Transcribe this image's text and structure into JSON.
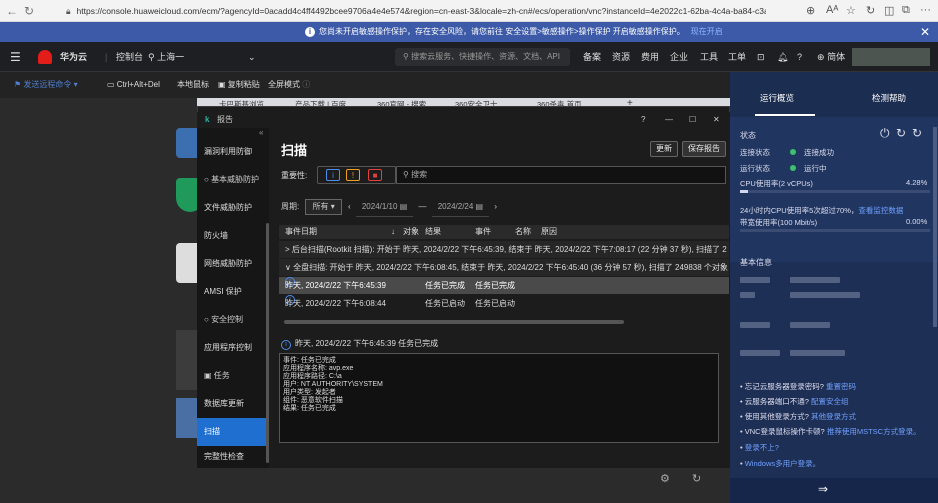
{
  "browser": {
    "url": "https://console.huaweicloud.com/ecm/?agencyId=0acadd4c4ff4492bcee9706a4e4e574&region=cn-east-3&locale=zh-cn#/ecs/operation/vnc?instanceId=4e2022c1-62ba-4c4a-ba84-c3a091d7a240",
    "zoom": "Aᴬ",
    "dots": "···"
  },
  "notice": {
    "text": "您尚未开启敏感操作保护，存在安全风险，请您前往 安全设置>敏感操作>操作保护 开启敏感操作保护。",
    "link": "现在开启",
    "close": "✕"
  },
  "header": {
    "brand": "华为云",
    "console": "控制台",
    "region": "上海一",
    "search_placeholder": "搜索云服务、快捷操作、资源、文档、API",
    "links": [
      "备案",
      "资源",
      "费用",
      "企业",
      "工具",
      "工单"
    ],
    "lang": "简体"
  },
  "vnc_toolbar": {
    "send_remote": "发送远程命令",
    "ctrl_alt_del": "Ctrl+Alt+Del",
    "local_mouse": "本地鼠标",
    "copy_paste": "复制粘贴",
    "fullscreen": "全屏模式"
  },
  "remote": {
    "tabs": [
      "卡巴斯基浏览...",
      "产品下载 | 百度...",
      "360官网 - 搜索...",
      "360安全卫士...",
      "360杀毒 首页..."
    ],
    "app_title": "报告",
    "window_controls": [
      "?",
      "—",
      "☐",
      "✕"
    ],
    "sidebar": [
      {
        "label": "漏洞利用防御",
        "section": false,
        "active": false
      },
      {
        "label": "基本威胁防护",
        "section": true,
        "active": false
      },
      {
        "label": "文件威胁防护",
        "section": false,
        "active": false
      },
      {
        "label": "防火墙",
        "section": false,
        "active": false
      },
      {
        "label": "网络威胁防护",
        "section": false,
        "active": false
      },
      {
        "label": "AMSI 保护",
        "section": false,
        "active": false
      },
      {
        "label": "安全控制",
        "section": true,
        "active": false
      },
      {
        "label": "应用程序控制",
        "section": false,
        "active": false
      },
      {
        "label": "任务",
        "section": true,
        "active": false
      },
      {
        "label": "数据库更新",
        "section": false,
        "active": false
      },
      {
        "label": "扫描",
        "section": false,
        "active": true
      },
      {
        "label": "完整性检查",
        "section": false,
        "active": false
      }
    ],
    "main": {
      "title": "扫描",
      "update_btn": "更新",
      "save_btn": "保存报告",
      "importance_label": "重要性:",
      "search_placeholder": "搜索",
      "period_label": "周期:",
      "period_value": "所有",
      "date_from": "2024/1/10",
      "date_to": "2024/2/24",
      "columns": [
        "事件日期",
        "对象",
        "结果",
        "事件",
        "名称",
        "原因"
      ],
      "rows": [
        {
          "text": "> 后台扫描(Rootkit 扫描): 开始于 昨天, 2024/2/22 下午6:45:39, 结束于 昨天, 2024/2/22 下午7:08:17 (22 分钟 37 秒), 扫描了 2",
          "type": "group"
        },
        {
          "text": "∨ 全盘扫描: 开始于 昨天, 2024/2/22 下午6:08:45, 结束于 昨天, 2024/2/22 下午6:45:40 (36 分钟 57 秒), 扫描了 249838 个对象",
          "type": "group"
        },
        {
          "date": "昨天, 2024/2/22 下午6:45:39",
          "result": "任务已完成",
          "event": "任务已完成",
          "type": "item",
          "highlight": true
        },
        {
          "date": "昨天, 2024/2/22 下午6:08:44",
          "result": "任务已启动",
          "event": "任务已启动",
          "type": "item",
          "highlight": false
        }
      ],
      "detail_head": "昨天, 2024/2/22 下午6:45:39 任务已完成",
      "detail_body": "事件: 任务已完成\n应用程序名称: avp.exe\n应用程序路径: C:\\a\n用户: NT AUTHORITY\\SYSTEM\n用户类型: 发起者\n组件: 恶意软件扫描\n结果: 任务已完成"
    }
  },
  "rpanel": {
    "tab_overview": "运行概览",
    "tab_help": "检测帮助",
    "status_title": "状态",
    "conn_label": "连接状态",
    "conn_value": "连接成功",
    "run_label": "运行状态",
    "run_value": "运行中",
    "cpu_label": "CPU使用率(2 vCPUs)",
    "cpu_value": "4.28%",
    "cpu_level": 0.0428,
    "cpu_note": "24小时内CPU使用率5次超过70%，",
    "cpu_note_link": "查看监控数据",
    "bw_label": "带宽使用率(100 Mbit/s)",
    "bw_value": "0.00%",
    "basic_title": "基本信息",
    "tips": [
      {
        "text": "忘记云服务器登录密码?",
        "link": "重置密码"
      },
      {
        "text": "云服务器端口不通?",
        "link": "配置安全组"
      },
      {
        "text": "使用其他登录方式?",
        "link": "其他登录方式"
      },
      {
        "text": "VNC登录鼠标操作卡顿?",
        "link": "推荐使用MSTSC方式登录。"
      },
      {
        "text": "",
        "link": "登录不上?"
      },
      {
        "text": "",
        "link": "Windows多用户登录。"
      }
    ],
    "bottom_arrow": "⇒"
  },
  "colors": {
    "accent": "#1f6fd1",
    "notice_bg": "#3c5aa8",
    "panel_bg": "#1e2f55",
    "ok": "#3bc36b"
  }
}
